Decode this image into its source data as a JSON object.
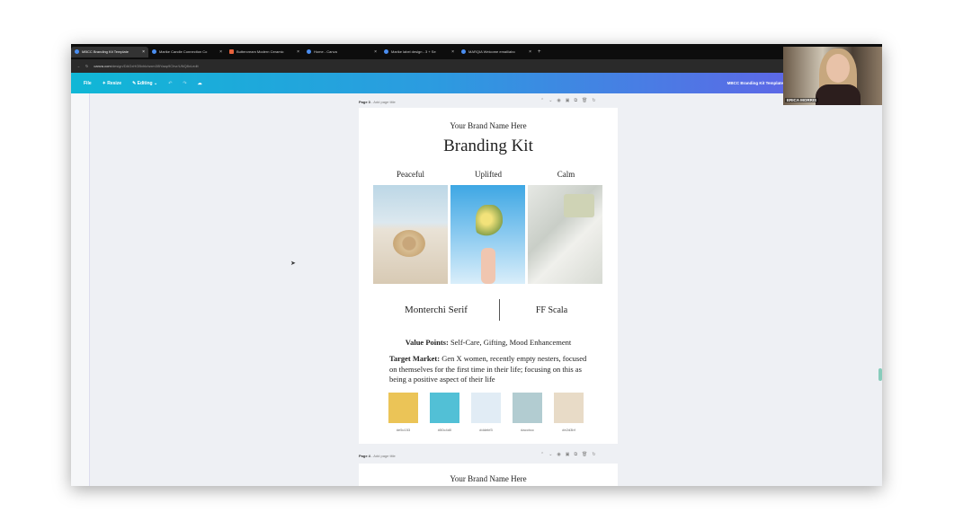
{
  "browser": {
    "tabs": [
      {
        "label": "MBCC Branding Kit Template",
        "icon": "canva-icon"
      },
      {
        "label": "Marike Candle Connection Co",
        "icon": "globe-icon"
      },
      {
        "label": "Buttercream Modern Ceramic",
        "icon": "shop-icon"
      },
      {
        "label": "Home - Canva",
        "icon": "canva-icon"
      },
      {
        "label": "Marike label design - 3 + Se",
        "icon": "canva-icon"
      },
      {
        "label": "MARQIA Welcome email/abo",
        "icon": "mail-icon"
      }
    ],
    "url_domain": "canva.com",
    "url_path": "/design/DAGxHGBxhk/wxm3l5Yaap9Chvr/UNQ8vLedit"
  },
  "toolbar": {
    "file": "File",
    "resize": "Resize",
    "editing": "Editing",
    "doc_title": "MBCC Branding Kit Template"
  },
  "pages": [
    {
      "label": "Page 3",
      "title_placeholder": "- Add page title"
    },
    {
      "label": "Page 4",
      "title_placeholder": "- Add page title"
    }
  ],
  "kit": {
    "brand_name": "Your Brand Name Here",
    "title": "Branding Kit",
    "moods": [
      "Peaceful",
      "Uplifted",
      "Calm"
    ],
    "font1": "Monterchi Serif",
    "font2": "FF Scala",
    "value_points_label": "Value Points:",
    "value_points": " Self-Care, Gifting, Mood Enhancement",
    "target_label": "Target Market:",
    "target": " Gen X women, recently empty nesters, focused on themselves for the first time in their life; focusing on this as being a positive aspect of their life",
    "swatches": [
      {
        "hex": "#e5c153",
        "color": "#ebc457"
      },
      {
        "hex": "#50c4d0",
        "color": "#52c0d6"
      },
      {
        "hex": "#ddebf3",
        "color": "#e1ecf5"
      },
      {
        "hex": "#accbcc",
        "color": "#b2ccd1"
      },
      {
        "hex": "#e2d3bf",
        "color": "#e8dbc7"
      }
    ]
  },
  "page4": {
    "brand_name": "Your Brand Name Here"
  },
  "webcam": {
    "name": "ERICA MORRIS"
  }
}
